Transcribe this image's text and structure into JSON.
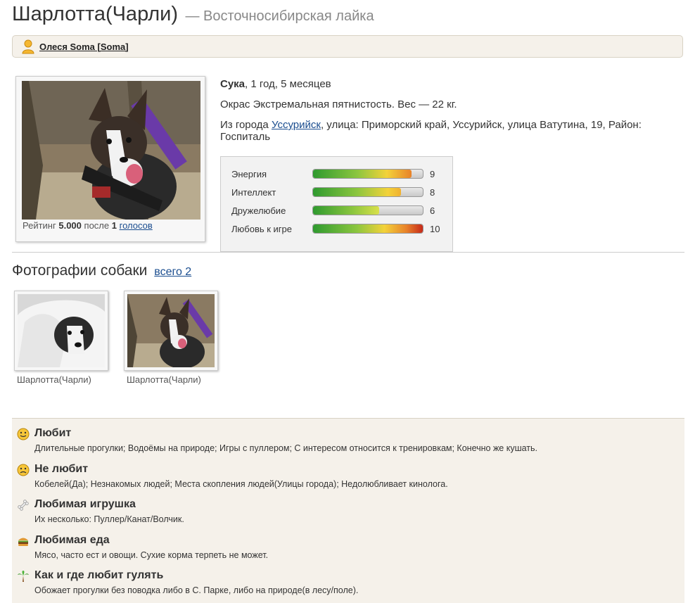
{
  "dog": {
    "name": "Шарлотта(Чарли)",
    "breed": "— Восточносибирская лайка"
  },
  "owner": {
    "name": "Олеся Soma [Soma]"
  },
  "rating": {
    "prefix": "Рейтинг",
    "score": "5.000",
    "middle": "после",
    "count": "1",
    "votes_link": "голосов"
  },
  "info": {
    "gender": "Сука",
    "age": ", 1 год, 5 месяцев",
    "color_weight": "Окрас Экстремальная пятнистость. Вес — 22 кг.",
    "city_prefix": "Из города",
    "city": "Уссурийск",
    "address": ", улица: Приморский край, Уссурийск, улица Ватутина, 19, Район: Госпиталь"
  },
  "stats": [
    {
      "label": "Энергия",
      "value": "9",
      "level": 0.9
    },
    {
      "label": "Интеллект",
      "value": "8",
      "level": 0.8
    },
    {
      "label": "Дружелюбие",
      "value": "6",
      "level": 0.6
    },
    {
      "label": "Любовь к игре",
      "value": "10",
      "level": 1.0
    }
  ],
  "photos": {
    "heading": "Фотографии собаки",
    "all_link": "всего 2",
    "items": [
      {
        "caption": "Шарлотта(Чарли)"
      },
      {
        "caption": "Шарлотта(Чарли)"
      }
    ]
  },
  "traits": [
    {
      "icon": "smile-icon",
      "title": "Любит",
      "text": "Длительные прогулки; Водоёмы на природе; Игры с пуллером; С интересом относится к тренировкам; Конечно же кушать."
    },
    {
      "icon": "sad-face-icon",
      "title": "Не любит",
      "text": "Кобелей(Да); Незнакомых людей; Места скопления людей(Улицы города); Недолюбливает кинолога."
    },
    {
      "icon": "bone-icon",
      "title": "Любимая игрушка",
      "text": "Их несколько: Пуллер/Канат/Волчик."
    },
    {
      "icon": "burger-icon",
      "title": "Любимая еда",
      "text": "Мясо, часто ест и овощи. Сухие корма терпеть не может."
    },
    {
      "icon": "palm-tree-icon",
      "title": "Как и где любит гулять",
      "text": "Обожает прогулки без поводка либо в С. Парке, либо на природе(в лесу/поле)."
    }
  ],
  "colors": {
    "link": "#1a4d8f",
    "owner_bar_bg": "#f5f1ea",
    "traits_bg": "#f5f1ea",
    "stats_bg": "#f2f2f2"
  }
}
